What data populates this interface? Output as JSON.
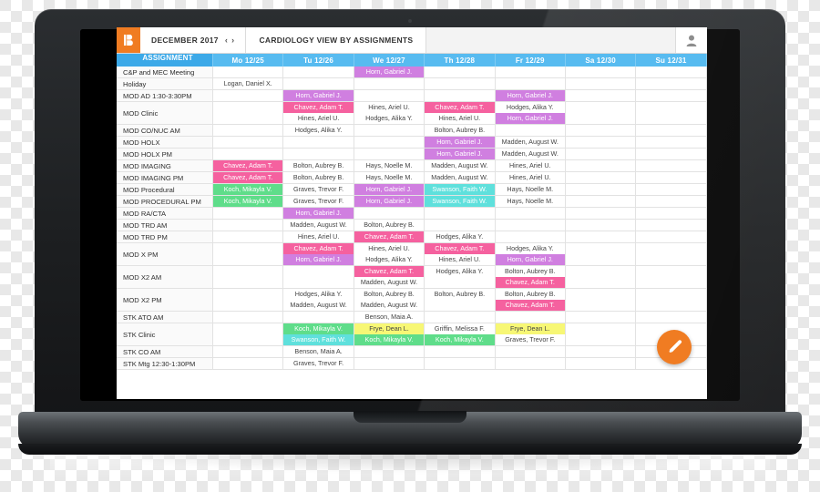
{
  "app": {
    "logo_glyph": "B",
    "month_label": "DECEMBER 2017",
    "prev_label": "‹",
    "next_label": "›",
    "view_title": "CARDIOLOGY VIEW BY ASSIGNMENTS",
    "accent_color": "#f07c22",
    "header_blue": "#57bbf0",
    "fab_label": "edit-pencil-icon"
  },
  "table": {
    "columns": [
      "ASSIGNMENT",
      "Mo 12/25",
      "Tu 12/26",
      "We 12/27",
      "Th 12/28",
      "Fr 12/29",
      "Sa 12/30",
      "Su 12/31"
    ],
    "legend_colors": {
      "pink": "#f5619f",
      "purple": "#d07fe0",
      "green": "#5fdd8a",
      "teal": "#5fe0dc",
      "yellow": "#f7f775",
      "plain": "transparent"
    },
    "rows": [
      {
        "label": "C&P and MEC Meeting",
        "cells": [
          [],
          [],
          [
            {
              "t": "Horn, Gabriel J.",
              "c": "purple"
            }
          ],
          [],
          [],
          [],
          []
        ]
      },
      {
        "label": "Holiday",
        "cells": [
          [
            {
              "t": "Logan, Daniel X.",
              "c": "plain"
            }
          ],
          [],
          [],
          [],
          [],
          [],
          []
        ]
      },
      {
        "label": "MOD AD 1:30-3:30PM",
        "cells": [
          [],
          [
            {
              "t": "Horn, Gabriel J.",
              "c": "purple"
            }
          ],
          [],
          [],
          [
            {
              "t": "Horn, Gabriel J.",
              "c": "purple"
            }
          ],
          [],
          []
        ]
      },
      {
        "label": "MOD Clinic",
        "cells": [
          [],
          [
            {
              "t": "Chavez, Adam T.",
              "c": "pink"
            },
            {
              "t": "Hines, Ariel U.",
              "c": "plain"
            }
          ],
          [
            {
              "t": "Hines, Ariel U.",
              "c": "plain"
            },
            {
              "t": "Hodges, Alika Y.",
              "c": "plain"
            }
          ],
          [
            {
              "t": "Chavez, Adam T.",
              "c": "pink"
            },
            {
              "t": "Hines, Ariel U.",
              "c": "plain"
            }
          ],
          [
            {
              "t": "Hodges, Alika Y.",
              "c": "plain"
            },
            {
              "t": "Horn, Gabriel J.",
              "c": "purple"
            }
          ],
          [],
          []
        ]
      },
      {
        "label": "MOD CO/NUC AM",
        "cells": [
          [],
          [
            {
              "t": "Hodges, Alika Y.",
              "c": "plain"
            }
          ],
          [],
          [
            {
              "t": "Bolton, Aubrey B.",
              "c": "plain"
            }
          ],
          [],
          [],
          []
        ]
      },
      {
        "label": "MOD HOLX",
        "cells": [
          [],
          [],
          [],
          [
            {
              "t": "Horn, Gabriel J.",
              "c": "purple"
            }
          ],
          [
            {
              "t": "Madden, August W.",
              "c": "plain"
            }
          ],
          [],
          []
        ]
      },
      {
        "label": "MOD HOLX PM",
        "cells": [
          [],
          [],
          [],
          [
            {
              "t": "Horn, Gabriel J.",
              "c": "purple"
            }
          ],
          [
            {
              "t": "Madden, August W.",
              "c": "plain"
            }
          ],
          [],
          []
        ]
      },
      {
        "label": "MOD IMAGING",
        "cells": [
          [
            {
              "t": "Chavez, Adam T.",
              "c": "pink"
            }
          ],
          [
            {
              "t": "Bolton, Aubrey B.",
              "c": "plain"
            }
          ],
          [
            {
              "t": "Hays, Noelle M.",
              "c": "plain"
            }
          ],
          [
            {
              "t": "Madden, August W.",
              "c": "plain"
            }
          ],
          [
            {
              "t": "Hines, Ariel U.",
              "c": "plain"
            }
          ],
          [],
          []
        ]
      },
      {
        "label": "MOD IMAGING PM",
        "cells": [
          [
            {
              "t": "Chavez, Adam T.",
              "c": "pink"
            }
          ],
          [
            {
              "t": "Bolton, Aubrey B.",
              "c": "plain"
            }
          ],
          [
            {
              "t": "Hays, Noelle M.",
              "c": "plain"
            }
          ],
          [
            {
              "t": "Madden, August W.",
              "c": "plain"
            }
          ],
          [
            {
              "t": "Hines, Ariel U.",
              "c": "plain"
            }
          ],
          [],
          []
        ]
      },
      {
        "label": "MOD Procedural",
        "cells": [
          [
            {
              "t": "Koch, Mikayla V.",
              "c": "green"
            }
          ],
          [
            {
              "t": "Graves, Trevor F.",
              "c": "plain"
            }
          ],
          [
            {
              "t": "Horn, Gabriel J.",
              "c": "purple"
            }
          ],
          [
            {
              "t": "Swanson, Faith W.",
              "c": "teal"
            }
          ],
          [
            {
              "t": "Hays, Noelle M.",
              "c": "plain"
            }
          ],
          [],
          []
        ]
      },
      {
        "label": "MOD PROCEDURAL PM",
        "cells": [
          [
            {
              "t": "Koch, Mikayla V.",
              "c": "green"
            }
          ],
          [
            {
              "t": "Graves, Trevor F.",
              "c": "plain"
            }
          ],
          [
            {
              "t": "Horn, Gabriel J.",
              "c": "purple"
            }
          ],
          [
            {
              "t": "Swanson, Faith W.",
              "c": "teal"
            }
          ],
          [
            {
              "t": "Hays, Noelle M.",
              "c": "plain"
            }
          ],
          [],
          []
        ]
      },
      {
        "label": "MOD RA/CTA",
        "cells": [
          [],
          [
            {
              "t": "Horn, Gabriel J.",
              "c": "purple"
            }
          ],
          [],
          [],
          [],
          [],
          []
        ]
      },
      {
        "label": "MOD TRD AM",
        "cells": [
          [],
          [
            {
              "t": "Madden, August W.",
              "c": "plain"
            }
          ],
          [
            {
              "t": "Bolton, Aubrey B.",
              "c": "plain"
            }
          ],
          [],
          [],
          [],
          []
        ]
      },
      {
        "label": "MOD TRD PM",
        "cells": [
          [],
          [
            {
              "t": "Hines, Ariel U.",
              "c": "plain"
            }
          ],
          [
            {
              "t": "Chavez, Adam T.",
              "c": "pink"
            }
          ],
          [
            {
              "t": "Hodges, Alika Y.",
              "c": "plain"
            }
          ],
          [],
          [],
          []
        ]
      },
      {
        "label": "MOD X PM",
        "cells": [
          [],
          [
            {
              "t": "Chavez, Adam T.",
              "c": "pink"
            },
            {
              "t": "Horn, Gabriel J.",
              "c": "purple"
            }
          ],
          [
            {
              "t": "Hines, Ariel U.",
              "c": "plain"
            },
            {
              "t": "Hodges, Alika Y.",
              "c": "plain"
            }
          ],
          [
            {
              "t": "Chavez, Adam T.",
              "c": "pink"
            },
            {
              "t": "Hines, Ariel U.",
              "c": "plain"
            }
          ],
          [
            {
              "t": "Hodges, Alika Y.",
              "c": "plain"
            },
            {
              "t": "Horn, Gabriel J.",
              "c": "purple"
            }
          ],
          [],
          []
        ]
      },
      {
        "label": "MOD X2 AM",
        "cells": [
          [],
          [],
          [
            {
              "t": "Chavez, Adam T.",
              "c": "pink"
            },
            {
              "t": "Madden, August W.",
              "c": "plain"
            }
          ],
          [
            {
              "t": "Hodges, Alika Y.",
              "c": "plain"
            }
          ],
          [
            {
              "t": "Bolton, Aubrey B.",
              "c": "plain"
            },
            {
              "t": "Chavez, Adam T.",
              "c": "pink"
            }
          ],
          [],
          []
        ]
      },
      {
        "label": "MOD X2 PM",
        "cells": [
          [],
          [
            {
              "t": "Hodges, Alika Y.",
              "c": "plain"
            },
            {
              "t": "Madden, August W.",
              "c": "plain"
            }
          ],
          [
            {
              "t": "Bolton, Aubrey B.",
              "c": "plain"
            },
            {
              "t": "Madden, August W.",
              "c": "plain"
            }
          ],
          [
            {
              "t": "Bolton, Aubrey B.",
              "c": "plain"
            }
          ],
          [
            {
              "t": "Bolton, Aubrey B.",
              "c": "plain"
            },
            {
              "t": "Chavez, Adam T.",
              "c": "pink"
            }
          ],
          [],
          []
        ]
      },
      {
        "label": "STK ATO AM",
        "cells": [
          [],
          [],
          [
            {
              "t": "Benson, Maia A.",
              "c": "plain"
            }
          ],
          [],
          [],
          [],
          []
        ]
      },
      {
        "label": "STK Clinic",
        "cells": [
          [],
          [
            {
              "t": "Koch, Mikayla V.",
              "c": "green"
            },
            {
              "t": "Swanson, Faith W.",
              "c": "teal"
            }
          ],
          [
            {
              "t": "Frye, Dean L.",
              "c": "yellow"
            },
            {
              "t": "Koch, Mikayla V.",
              "c": "green"
            }
          ],
          [
            {
              "t": "Griffin, Melissa F.",
              "c": "plain"
            },
            {
              "t": "Koch, Mikayla V.",
              "c": "green"
            }
          ],
          [
            {
              "t": "Frye, Dean L.",
              "c": "yellow"
            },
            {
              "t": "Graves, Trevor F.",
              "c": "plain"
            }
          ],
          [],
          []
        ]
      },
      {
        "label": "STK CO AM",
        "cells": [
          [],
          [
            {
              "t": "Benson, Maia A.",
              "c": "plain"
            }
          ],
          [],
          [],
          [],
          [],
          []
        ]
      },
      {
        "label": "STK Mtg 12:30-1:30PM",
        "cells": [
          [],
          [
            {
              "t": "Graves, Trevor F.",
              "c": "plain"
            }
          ],
          [],
          [],
          [],
          [],
          []
        ]
      }
    ]
  }
}
